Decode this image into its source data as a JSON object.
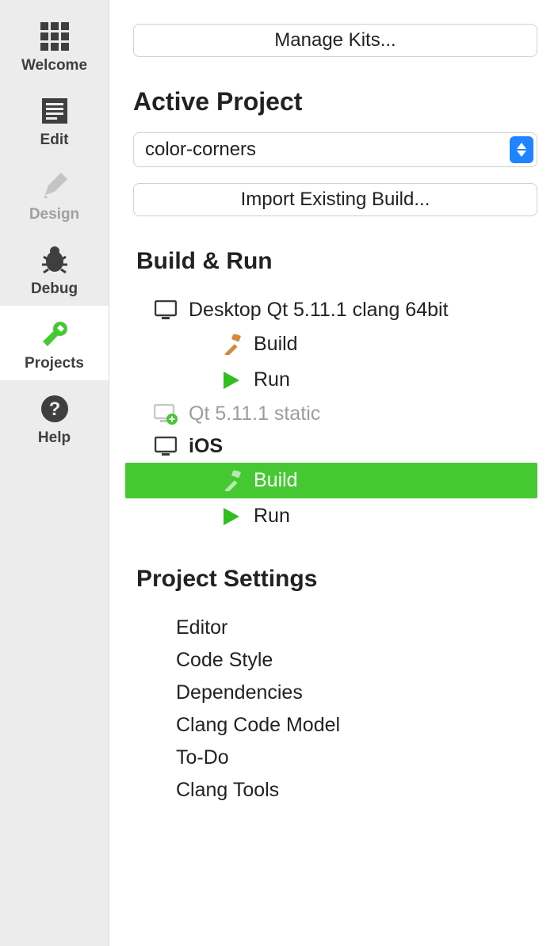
{
  "sidebar": [
    {
      "id": "welcome",
      "label": "Welcome",
      "active": false,
      "dim": false
    },
    {
      "id": "edit",
      "label": "Edit",
      "active": false,
      "dim": false
    },
    {
      "id": "design",
      "label": "Design",
      "active": false,
      "dim": true
    },
    {
      "id": "debug",
      "label": "Debug",
      "active": false,
      "dim": false
    },
    {
      "id": "projects",
      "label": "Projects",
      "active": true,
      "dim": false
    },
    {
      "id": "help",
      "label": "Help",
      "active": false,
      "dim": false
    }
  ],
  "manage_kits_label": "Manage Kits...",
  "active_project_heading": "Active Project",
  "active_project_value": "color-corners",
  "import_build_label": "Import Existing Build...",
  "build_run_heading": "Build & Run",
  "kits": [
    {
      "name": "Desktop Qt 5.11.1 clang 64bit",
      "icon": "desktop",
      "dim": false,
      "bold": false,
      "children": [
        {
          "label": "Build",
          "icon": "hammer",
          "selected": false
        },
        {
          "label": "Run",
          "icon": "play",
          "selected": false
        }
      ]
    },
    {
      "name": "Qt 5.11.1 static",
      "icon": "add-device",
      "dim": true,
      "bold": false,
      "children": []
    },
    {
      "name": "iOS",
      "icon": "desktop",
      "dim": false,
      "bold": true,
      "children": [
        {
          "label": "Build",
          "icon": "hammer",
          "selected": true
        },
        {
          "label": "Run",
          "icon": "play",
          "selected": false
        }
      ]
    }
  ],
  "project_settings_heading": "Project Settings",
  "project_settings": [
    "Editor",
    "Code Style",
    "Dependencies",
    "Clang Code Model",
    "To-Do",
    "Clang Tools"
  ]
}
